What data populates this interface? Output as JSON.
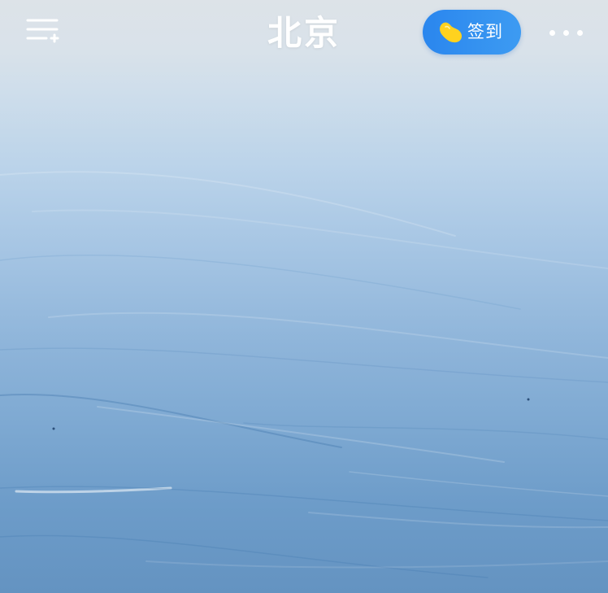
{
  "header": {
    "city": "北京",
    "signin_label": "签到",
    "menu_icon": "menu-add-icon",
    "more_icon": "more-dots-icon",
    "signin_icon": "bean-icon"
  },
  "colors": {
    "signin_button": "#2a86ee",
    "bean_icon": "#ffd21f",
    "text": "#ffffff",
    "sky_top": "#dde3e8",
    "sky_bottom": "#6493c1"
  }
}
